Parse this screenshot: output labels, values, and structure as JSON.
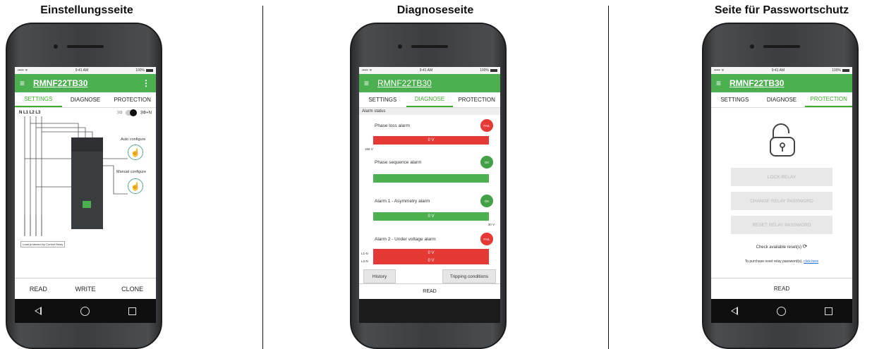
{
  "panels": [
    {
      "title": "Einstellungsseite"
    },
    {
      "title": "Diagnoseseite"
    },
    {
      "title": "Seite für Passwortschutz"
    }
  ],
  "status": {
    "carrier": "••••• ᯤ",
    "time": "9:41 AM",
    "battery": "100%"
  },
  "app": {
    "title": "RMNF22TB30",
    "menu_icon": "hamburger-icon",
    "more_icon": "kebab-icon"
  },
  "tabs": [
    "SETTINGS",
    "DIAGNOSE",
    "PROTECTION"
  ],
  "settings": {
    "phases": "N L1 L2 L3",
    "mode_left": "3Φ",
    "mode_right": "3Φ+N",
    "auto_configure": "Auto configure",
    "manual_configure": "Manual configure",
    "caption": "Load protected by Control Relay",
    "buttons": [
      "READ",
      "WRITE",
      "CLONE"
    ]
  },
  "diagnose": {
    "section": "Alarm status",
    "alarms": [
      {
        "name": "Phase loss alarm",
        "status": "FAIL",
        "value": "0 V",
        "label_below": "168 V"
      },
      {
        "name": "Phase sequence alarm",
        "status": "OK",
        "value": ""
      },
      {
        "name": "Alarm 1 - Asymmetry alarm",
        "status": "OK",
        "value": "0 V",
        "label_below": "30 V"
      },
      {
        "name": "Alarm 2 - Under voltage alarm",
        "status": "FAIL",
        "value1": "0 V",
        "value2": "0 V",
        "line1": "L1-N",
        "line2": "L2-N"
      }
    ],
    "history": "History",
    "tripping": "Tripping conditions",
    "read": "READ"
  },
  "protection": {
    "lock": "LOCK RELAY",
    "change": "CHANGE RELAY PASSWORD",
    "reset": "RESET RELAY PASSWORD",
    "check": "Check available reset(s)",
    "purchase": "To purchase reset relay password(s),",
    "click_here": "click here",
    "read": "READ"
  },
  "colors": {
    "green": "#4caf50",
    "red": "#e53935",
    "tab_active": "#3dae2b"
  }
}
